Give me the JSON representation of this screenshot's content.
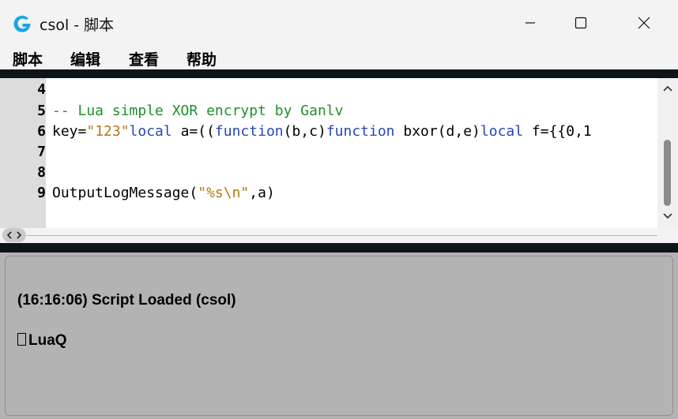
{
  "window": {
    "title": "csol - 脚本",
    "controls": {
      "minimize": "minimize-icon",
      "maximize": "maximize-icon",
      "close": "close-icon"
    }
  },
  "menu": {
    "items": [
      {
        "label": "脚本"
      },
      {
        "label": "编辑"
      },
      {
        "label": "查看"
      },
      {
        "label": "帮助"
      }
    ]
  },
  "editor": {
    "lines": [
      {
        "number": "4",
        "tokens": []
      },
      {
        "number": "5",
        "tokens": [
          {
            "type": "comment",
            "text": "-- Lua simple XOR encrypt by Ganlv"
          }
        ]
      },
      {
        "number": "6",
        "tokens": [
          {
            "type": "plain",
            "text": "key="
          },
          {
            "type": "string",
            "text": "\"123\""
          },
          {
            "type": "keyword",
            "text": "local"
          },
          {
            "type": "plain",
            "text": " a=(("
          },
          {
            "type": "keyword",
            "text": "function"
          },
          {
            "type": "plain",
            "text": "(b,c)"
          },
          {
            "type": "keyword",
            "text": "function"
          },
          {
            "type": "plain",
            "text": " bxor(d,e)"
          },
          {
            "type": "keyword",
            "text": "local"
          },
          {
            "type": "plain",
            "text": " f={{0,1"
          }
        ]
      },
      {
        "number": "7",
        "tokens": []
      },
      {
        "number": "8",
        "tokens": []
      },
      {
        "number": "9",
        "tokens": [
          {
            "type": "plain",
            "text": "OutputLogMessage("
          },
          {
            "type": "string",
            "text": "\"%s\\n\""
          },
          {
            "type": "plain",
            "text": ",a)"
          }
        ]
      }
    ],
    "colors": {
      "comment": "#1f8f2b",
      "string": "#b3781a",
      "keyword": "#2448b8",
      "plain": "#000000"
    }
  },
  "output": {
    "lines": [
      {
        "text": "(16:16:06) Script Loaded (csol)",
        "has_box": false
      },
      {
        "text": "LuaQ",
        "has_box": true
      }
    ]
  },
  "colors": {
    "separator": "#0f1517",
    "gutter": "#dcdcdc",
    "output_bg": "#b3b3b3"
  }
}
